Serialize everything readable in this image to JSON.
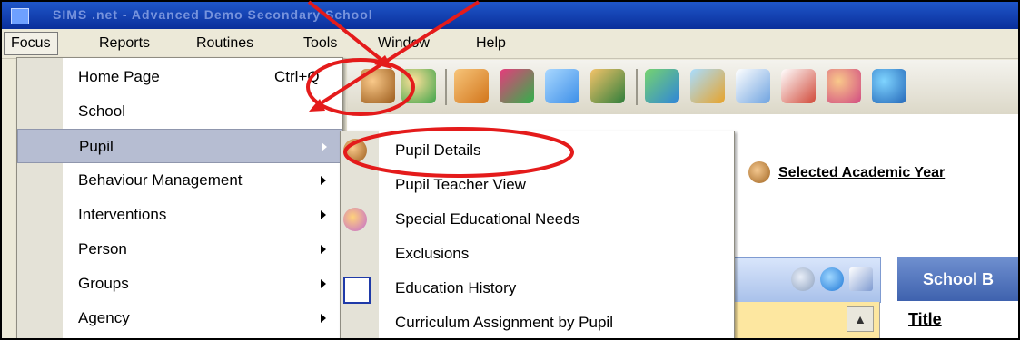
{
  "titlebar": {
    "text": "SIMS .net - Advanced Demo Secondary School"
  },
  "menubar": {
    "items": [
      {
        "label": "Focus"
      },
      {
        "label": "Reports"
      },
      {
        "label": "Routines"
      },
      {
        "label": "Tools"
      },
      {
        "label": "Window"
      },
      {
        "label": "Help"
      }
    ]
  },
  "focus_menu": {
    "items": [
      {
        "label": "Home Page",
        "shortcut": "Ctrl+Q"
      },
      {
        "label": "School"
      },
      {
        "label": "Pupil",
        "selected": true
      },
      {
        "label": "Behaviour Management"
      },
      {
        "label": "Interventions"
      },
      {
        "label": "Person"
      },
      {
        "label": "Groups"
      },
      {
        "label": "Agency"
      }
    ]
  },
  "pupil_submenu": {
    "items": [
      {
        "label": "Pupil Details"
      },
      {
        "label": "Pupil Teacher View"
      },
      {
        "label": "Special Educational Needs"
      },
      {
        "label": "Exclusions"
      },
      {
        "label": "Education History"
      },
      {
        "label": "Curriculum Assignment by Pupil"
      }
    ]
  },
  "workspace": {
    "academic_year_label": "Selected Academic Year",
    "school_bulletin_header": "School B",
    "title_column": "Title"
  },
  "colors": {
    "annotation": "#e41b1b",
    "menu_highlight": "#b6bdd2",
    "panel_header": "#3f62ae"
  }
}
